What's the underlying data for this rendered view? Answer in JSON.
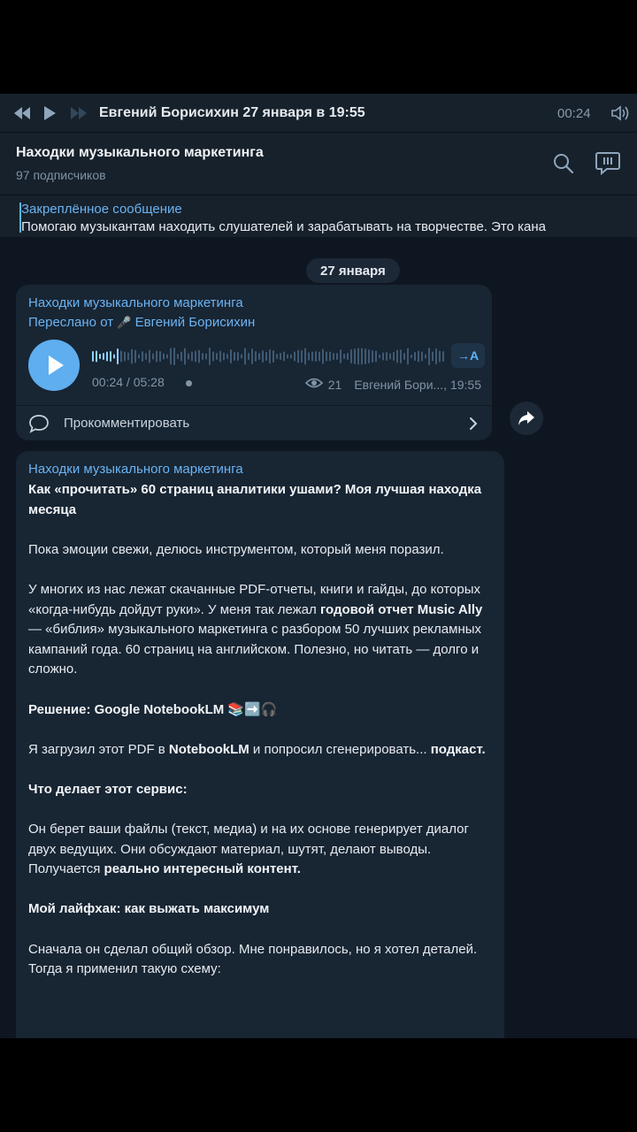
{
  "player": {
    "author_line": "Евгений Борисихин 27 января в 19:55",
    "current_time": "00:24"
  },
  "channel": {
    "title": "Находки музыкального маркетинга",
    "subscribers": "97 подписчиков"
  },
  "pinned": {
    "label": "Закреплённое сообщение",
    "text": "Помогаю музыкантам находить слушателей и зарабатывать на творчестве.  Это кана"
  },
  "date_chip": "27 января",
  "voice_message": {
    "channel": "Находки музыкального маркетинга",
    "forwarded_prefix": "Переслано от",
    "forwarded_emoji": "🎤",
    "forwarded_name": "Евгений Борисихин",
    "transcribe_label": "→A",
    "duration": "00:24 / 05:28",
    "progress": 0.075,
    "views": "21",
    "signature": "Евгений Бори..., 19:55",
    "comment_label": "Прокомментировать"
  },
  "post": {
    "channel": "Находки музыкального маркетинга",
    "title": "Как «прочитать» 60 страниц аналитики ушами? Моя лучшая находка месяца",
    "p1": "Пока эмоции свежи, делюсь инструментом, который меня поразил.",
    "p2a": "У многих из нас лежат скачанные PDF-отчеты, книги и гайды, до которых «когда-нибудь дойдут руки». У меня так лежал ",
    "p2b": "годовой отчет Music Ally",
    "p2c": " — «библия» музыкального маркетинга с разбором 50 лучших рекламных кампаний года. 60 страниц на английском. Полезно, но читать — долго и сложно.",
    "p3": "Решение: Google NotebookLM 📚➡️🎧",
    "p4a": "Я загрузил этот PDF в ",
    "p4b": "NotebookLM",
    "p4c": " и попросил сгенерировать... ",
    "p4d": "подкаст.",
    "p5": "Что делает этот сервис:",
    "p6a": "Он берет ваши файлы (текст, медиа) и на их основе генерирует диалог двух ведущих. Они обсуждают материал, шутят, делают выводы. Получается ",
    "p6b": "реально интересный контент.",
    "p7": "Мой лайфхак: как выжать максимум",
    "p8": "Сначала он сделал общий обзор. Мне понравилось, но я хотел деталей. Тогда я применил такую схему:"
  },
  "colors": {
    "background": "#0e1621",
    "header": "#17212b",
    "bubble": "#182533",
    "accent": "#6ab3f3",
    "play_button": "#5eaef0"
  }
}
